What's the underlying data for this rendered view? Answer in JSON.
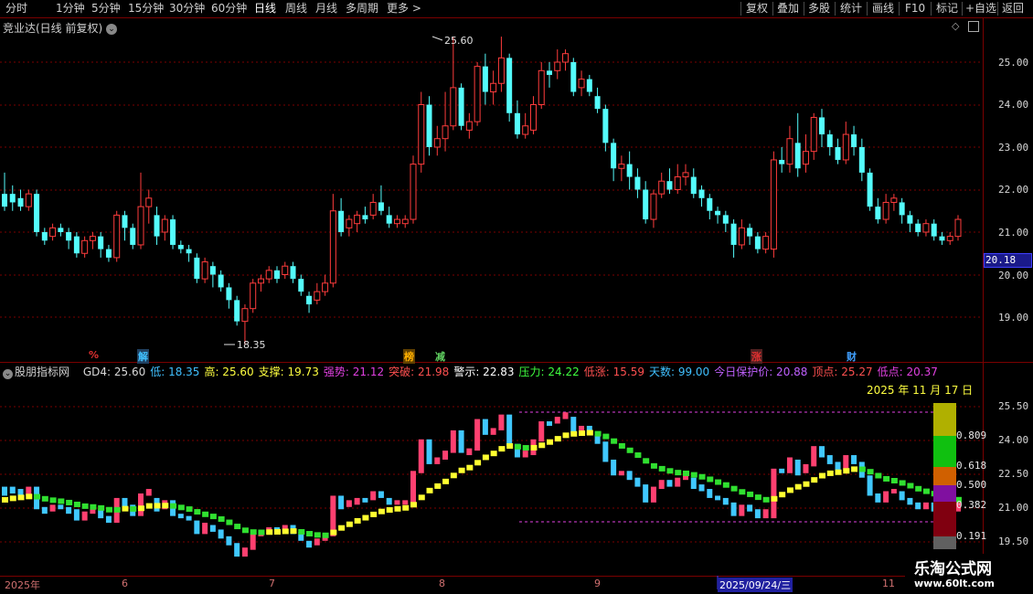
{
  "toolbar": {
    "periods": [
      "分时",
      "1分钟",
      "5分钟",
      "15分钟",
      "30分钟",
      "60分钟",
      "日线",
      "周线",
      "月线",
      "多周期",
      "更多"
    ],
    "active_period": "日线",
    "right_items": [
      "复权",
      "叠加",
      "多股",
      "统计",
      "画线",
      "F10",
      "标记",
      "+自选",
      "返回"
    ]
  },
  "main_chart": {
    "title": "竞业达(日线 前复权)",
    "price_ticks": [
      "25.00",
      "24.00",
      "23.00",
      "22.00",
      "21.00",
      "20.00",
      "19.00"
    ],
    "current_price_tag": "20.18",
    "high_label": "25.60",
    "low_label": "18.35"
  },
  "event_marks": [
    {
      "text": "%",
      "color": "#e03030"
    },
    {
      "text": "解",
      "color": "#40c0ff"
    },
    {
      "text": "榜",
      "color": "#ffb000"
    },
    {
      "text": "减",
      "color": "#60d060"
    },
    {
      "text": "涨",
      "color": "#e03030"
    },
    {
      "text": "财",
      "color": "#40a0ff"
    }
  ],
  "indicator": {
    "name": "股朋指标网",
    "values": [
      {
        "label": "GD4:",
        "value": "25.60",
        "color": "#d8d8d8"
      },
      {
        "label": "低:",
        "value": "18.35",
        "color": "#40c0ff"
      },
      {
        "label": "高:",
        "value": "25.60",
        "color": "#ffff40"
      },
      {
        "label": "支撑:",
        "value": "19.73",
        "color": "#ffff40"
      },
      {
        "label": "强势:",
        "value": "21.12",
        "color": "#e040e0"
      },
      {
        "label": "突破:",
        "value": "21.98",
        "color": "#ff5050"
      },
      {
        "label": "警示:",
        "value": "22.83",
        "color": "#ffffff"
      },
      {
        "label": "压力:",
        "value": "24.22",
        "color": "#40ff40"
      },
      {
        "label": "低涨:",
        "value": "15.59",
        "color": "#ff5050"
      },
      {
        "label": "天数:",
        "value": "99.00",
        "color": "#40c0ff"
      },
      {
        "label": "今日保护价:",
        "value": "20.88",
        "color": "#c060ff"
      },
      {
        "label": "顶点:",
        "value": "25.27",
        "color": "#ff5050"
      },
      {
        "label": "低点:",
        "value": "20.37",
        "color": "#e040e0"
      }
    ],
    "date": "2025 年 11 月 17 日",
    "ticks": [
      "25.50",
      "24.00",
      "22.50",
      "21.00",
      "19.50"
    ],
    "fib_labels": [
      "0.809",
      "0.618",
      "0.500",
      "0.382",
      "0.191"
    ]
  },
  "x_axis": {
    "labels": [
      "2025年",
      "6",
      "7",
      "8",
      "9",
      "2025/09/24/三",
      "11"
    ]
  },
  "watermark": {
    "line1": "乐淘公式网",
    "line2": "www.60lt.com"
  }
}
